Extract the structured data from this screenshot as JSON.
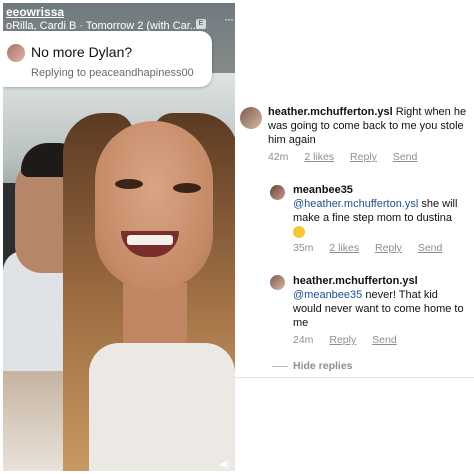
{
  "video": {
    "username": "eeowrissa",
    "music": "oRilla, Cardi B · Tomorrow 2 (with Car...",
    "music_badge": "E",
    "more": "···",
    "reply_card": {
      "title": "No more Dylan?",
      "subtitle": "Replying to peaceandhapiness00"
    }
  },
  "comments": [
    {
      "username": "heather.mchufferton.ysl",
      "text": " Right when he was going to come back to me you stole him again",
      "time": "42m",
      "likes": "2 likes",
      "reply": "Reply",
      "send": "Send"
    },
    {
      "username": "meanbee35",
      "mention": "@heather.mchufferton.ysl",
      "text": " she will make a fine step mom to dustina",
      "time": "35m",
      "likes": "2 likes",
      "reply": "Reply",
      "send": "Send"
    },
    {
      "username": "heather.mchufferton.ysl",
      "mention": "@meanbee35",
      "text": " never! That kid would never want to come home to me",
      "time": "24m",
      "reply": "Reply",
      "send": "Send"
    }
  ],
  "hide_replies": "Hide replies"
}
